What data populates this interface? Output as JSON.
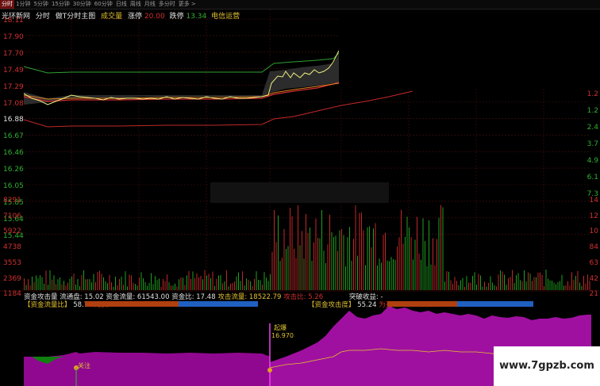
{
  "toolbar": {
    "tabs": [
      "分时",
      "1分钟",
      "5分钟",
      "15分钟",
      "30分钟",
      "60分钟",
      "日线",
      "周线",
      "月线",
      "多分时",
      "更多 >"
    ]
  },
  "header": {
    "stock_name": "光环新网",
    "mode_a": "分时",
    "mode_b": "做T分时主图",
    "volume_label": "成交量",
    "limit_up_label": "涨停",
    "limit_up_value": "20.00",
    "limit_down_label": "跌停",
    "limit_down_value": "13.34",
    "sector": "电信运营"
  },
  "price_axis_labels": [
    "18.11",
    "17.90",
    "17.70",
    "17.49",
    "17.29",
    "17.08",
    "16.88",
    "16.67",
    "16.46",
    "16.26",
    "16.05",
    "15.85",
    "15.64",
    "15.44"
  ],
  "pct_axis_labels": [
    "1.2",
    "1.2",
    "2.4",
    "3.7",
    "4.9",
    "6.1",
    "7.3"
  ],
  "volume_axis_labels": [
    "8291",
    "7106",
    "5922",
    "4738",
    "3553",
    "2369",
    "1184"
  ],
  "volume_axis_right": [
    "14",
    "12",
    "10",
    "84",
    "63",
    "42",
    "21"
  ],
  "indicator_line1": {
    "title": "资金攻击量",
    "float_label": "流通盘:",
    "float_value": "15.02",
    "flow_label": "资金流量:",
    "flow_value": "61543.00",
    "ratio_label": "资金比:",
    "ratio_value": "17.48",
    "attack_flow_label": "攻击流量:",
    "attack_flow_value": "18522.79",
    "attack_ratio_label": "攻击比:",
    "attack_ratio_value": "5.26",
    "breakout_label": "突破收益:",
    "breakout_value": "-"
  },
  "panel_left": {
    "label": "【资金流量比】",
    "value": "58.74",
    "action": "为买"
  },
  "panel_right": {
    "label": "【资金攻击度】",
    "value": "55.24",
    "action": "为买"
  },
  "annotations": {
    "watch_label": "关注",
    "start_label": "起爆",
    "start_price": "16.970"
  },
  "watermark": "www.7gpzb.com",
  "colors": {
    "red": "#d03030",
    "green": "#30b030",
    "magenta": "#a010a0",
    "yellow": "#f0f080"
  }
}
